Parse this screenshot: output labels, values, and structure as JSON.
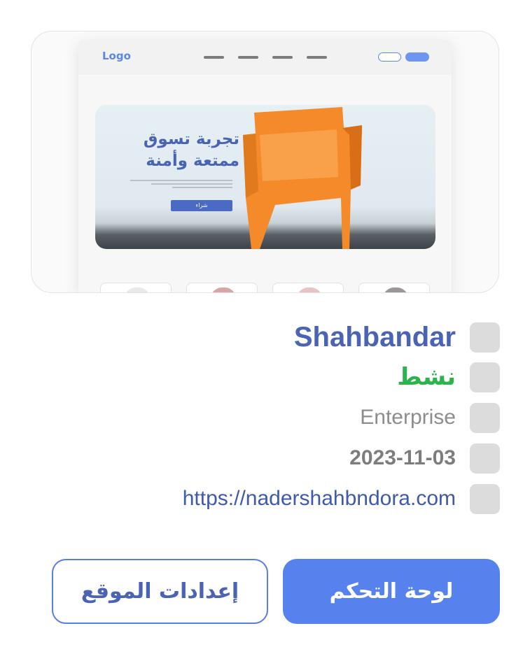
{
  "preview": {
    "logo_text": "Logo",
    "hero_title_line1": "تجربة تسوق",
    "hero_title_line2": "ممتعة وأمنة",
    "buy_label": "شراء",
    "hero_chair_color": "#f58a2a",
    "accent_color": "#5a86ee"
  },
  "site": {
    "name": "Shahbandar",
    "status": "نشط",
    "plan": "Enterprise",
    "date": "2023-11-03",
    "url": "https://nadershahbndora.com"
  },
  "actions": {
    "dashboard_label": "لوحة التحكم",
    "settings_label": "إعدادات الموقع"
  },
  "colors": {
    "primary": "#5782ee",
    "status_active": "#2bb34c",
    "title": "#4a63b5"
  }
}
